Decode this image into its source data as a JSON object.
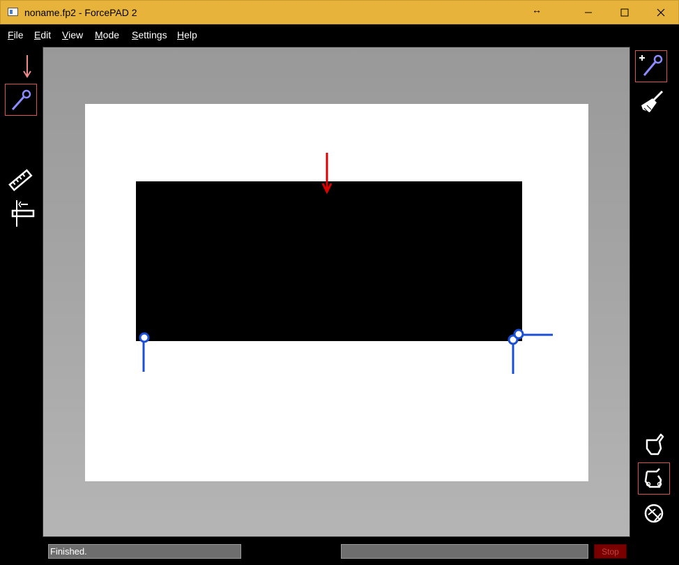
{
  "window": {
    "title": "noname.fp2 - ForcePAD 2",
    "resize_glyph": "↔",
    "controls": [
      "minimize-icon",
      "maximize-icon",
      "close-icon"
    ]
  },
  "menu": [
    {
      "u": "F",
      "rest": "ile"
    },
    {
      "u": "E",
      "rest": "dit"
    },
    {
      "u": "V",
      "rest": "iew"
    },
    {
      "u": "M",
      "rest": "ode"
    },
    {
      "u": "S",
      "rest": "ettings"
    },
    {
      "u": "H",
      "rest": "elp"
    }
  ],
  "left_toolbar": {
    "tools": [
      "force-arrow-icon",
      "constraint-pin-icon",
      "ruler-icon",
      "load-dimension-icon"
    ],
    "selected": "constraint-pin-icon"
  },
  "right_toolbar": {
    "tools": [
      "add-constraint-icon",
      "broom-icon",
      "result-shape-icon",
      "deformed-shape-icon",
      "stress-flow-icon"
    ],
    "selected": [
      "add-constraint-icon",
      "deformed-shape-icon"
    ]
  },
  "colors": {
    "force": "#e00000",
    "constraint": "#1a4fd6",
    "material": "#000000",
    "selection_border": "#d9534f",
    "stop_bg": "#7a0000"
  },
  "status": {
    "message": "Finished.",
    "stop_label": "Stop"
  }
}
